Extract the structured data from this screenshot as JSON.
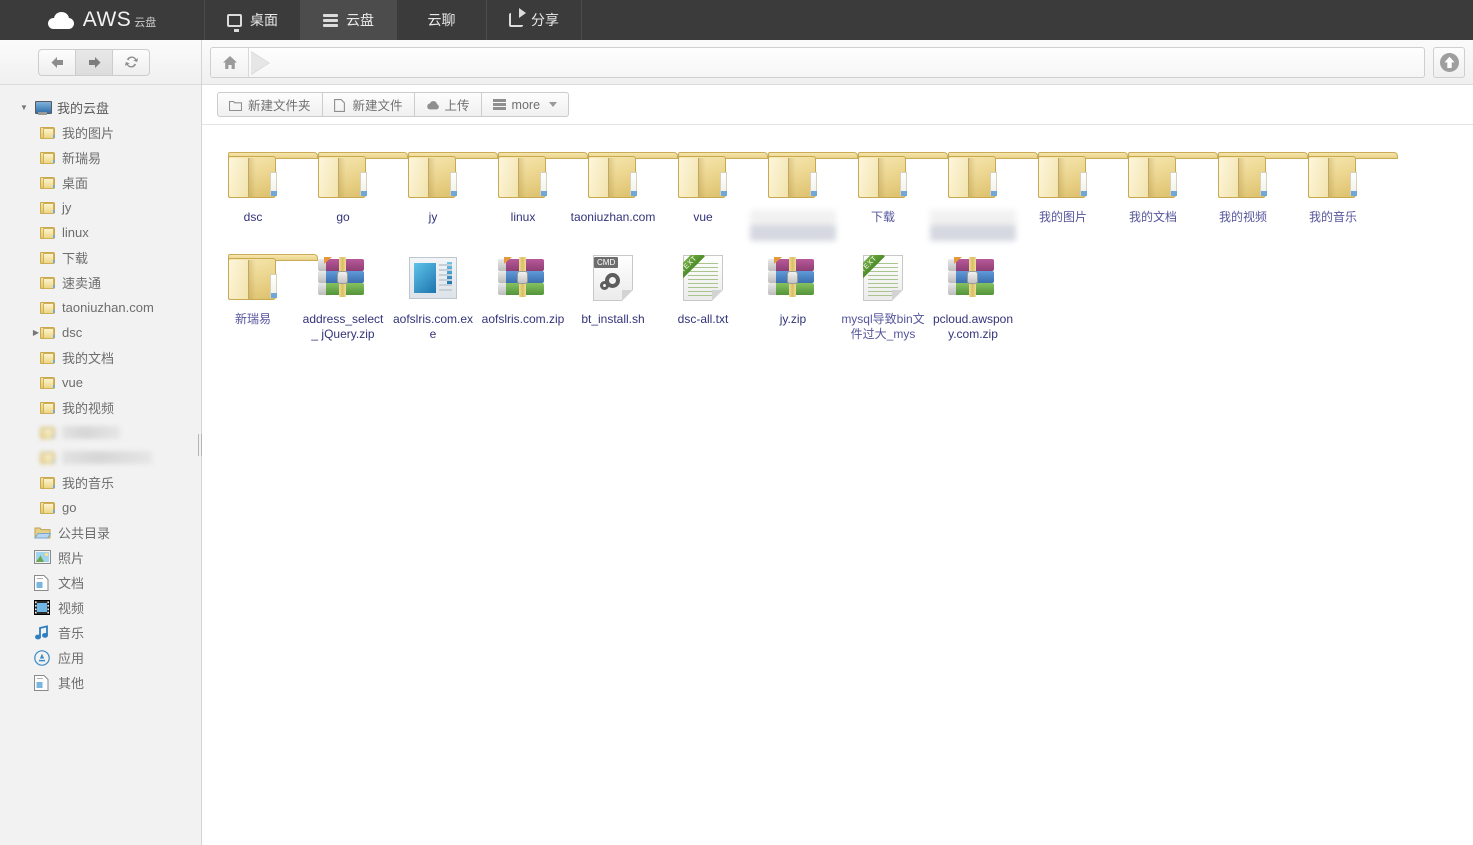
{
  "app": {
    "brand_name": "AWS",
    "brand_sub": "云盘",
    "tabs": [
      {
        "label": "桌面",
        "icon": "monitor-icon",
        "active": false
      },
      {
        "label": "云盘",
        "icon": "disk-icon",
        "active": true
      },
      {
        "label": "云聊",
        "icon": "none",
        "active": false
      },
      {
        "label": "分享",
        "icon": "share-icon",
        "active": false
      }
    ]
  },
  "nav": {
    "back_label": "←",
    "forward_label": "→",
    "refresh_label": "⟳"
  },
  "breadcrumb": {
    "home_icon": "home-icon",
    "path": "",
    "up_icon": "up-arrow-icon"
  },
  "toolbar": {
    "new_folder": "新建文件夹",
    "new_file": "新建文件",
    "upload": "上传",
    "more": "more"
  },
  "sidebar": {
    "root": {
      "label": "我的云盘",
      "icon": "computer-icon",
      "expanded": true
    },
    "children": [
      {
        "label": "我的图片",
        "icon": "folder-icon",
        "blurred": false,
        "twisty": false
      },
      {
        "label": "新瑞易",
        "icon": "folder-icon",
        "blurred": false,
        "twisty": false
      },
      {
        "label": "桌面",
        "icon": "folder-icon",
        "blurred": false,
        "twisty": false
      },
      {
        "label": "jy",
        "icon": "folder-icon",
        "blurred": false,
        "twisty": false
      },
      {
        "label": "linux",
        "icon": "folder-icon",
        "blurred": false,
        "twisty": false
      },
      {
        "label": "下载",
        "icon": "folder-icon",
        "blurred": false,
        "twisty": false
      },
      {
        "label": "速卖通",
        "icon": "folder-icon",
        "blurred": false,
        "twisty": false
      },
      {
        "label": "taoniuzhan.com",
        "icon": "folder-icon",
        "blurred": false,
        "twisty": false
      },
      {
        "label": "dsc",
        "icon": "folder-icon",
        "blurred": false,
        "twisty": true
      },
      {
        "label": "我的文档",
        "icon": "folder-icon",
        "blurred": false,
        "twisty": false
      },
      {
        "label": "vue",
        "icon": "folder-icon",
        "blurred": false,
        "twisty": false
      },
      {
        "label": "我的视频",
        "icon": "folder-icon",
        "blurred": false,
        "twisty": false
      },
      {
        "label": "",
        "icon": "folder-icon",
        "blurred": true,
        "twisty": false,
        "blur_width": 58
      },
      {
        "label": "",
        "icon": "folder-icon",
        "blurred": true,
        "twisty": false,
        "blur_width": 90
      },
      {
        "label": "我的音乐",
        "icon": "folder-icon",
        "blurred": false,
        "twisty": false
      },
      {
        "label": "go",
        "icon": "folder-icon",
        "blurred": false,
        "twisty": false
      }
    ],
    "sections": [
      {
        "label": "公共目录",
        "icon": "shared-folder-icon"
      },
      {
        "label": "照片",
        "icon": "photo-icon"
      },
      {
        "label": "文档",
        "icon": "document-icon"
      },
      {
        "label": "视频",
        "icon": "video-icon"
      },
      {
        "label": "音乐",
        "icon": "music-icon"
      },
      {
        "label": "应用",
        "icon": "app-icon"
      },
      {
        "label": "其他",
        "icon": "other-icon"
      }
    ]
  },
  "files": [
    {
      "name": "dsc",
      "type": "folder",
      "blurred": false
    },
    {
      "name": "go",
      "type": "folder",
      "blurred": false
    },
    {
      "name": "jy",
      "type": "folder",
      "blurred": false
    },
    {
      "name": "linux",
      "type": "folder",
      "blurred": false
    },
    {
      "name": "taoniuzhan.com",
      "type": "folder",
      "blurred": false
    },
    {
      "name": "vue",
      "type": "folder",
      "blurred": false
    },
    {
      "name": "",
      "type": "folder",
      "blurred": true
    },
    {
      "name": "下载",
      "type": "folder",
      "blurred": false
    },
    {
      "name": "",
      "type": "folder",
      "blurred": true
    },
    {
      "name": "我的图片",
      "type": "folder",
      "blurred": false
    },
    {
      "name": "我的文档",
      "type": "folder",
      "blurred": false
    },
    {
      "name": "我的视频",
      "type": "folder",
      "blurred": false
    },
    {
      "name": "我的音乐",
      "type": "folder",
      "blurred": false
    },
    {
      "name": "新瑞易",
      "type": "folder",
      "blurred": false
    },
    {
      "name": "address_select_ jQuery.zip",
      "type": "rar",
      "blurred": false
    },
    {
      "name": "aofslris.com.exe",
      "type": "exe",
      "blurred": false
    },
    {
      "name": "aofslris.com.zip",
      "type": "rar",
      "blurred": false
    },
    {
      "name": "bt_install.sh",
      "type": "sh",
      "blurred": false,
      "tag": "CMD"
    },
    {
      "name": "dsc-all.txt",
      "type": "txt",
      "blurred": false,
      "tag": "TEXT"
    },
    {
      "name": "jy.zip",
      "type": "rar",
      "blurred": false
    },
    {
      "name": "mysql导致bin文件过大_mys",
      "type": "txt",
      "blurred": false,
      "tag": "TEXT"
    },
    {
      "name": "pcloud.awspony.com.zip",
      "type": "rar",
      "blurred": false
    }
  ],
  "colors": {
    "topbar_bg": "#3b3b3b",
    "tab_active_bg": "#4c4c4c",
    "sidebar_bg": "#f2f2f2",
    "label_color": "#33337a",
    "folder_yellow": "#edd684",
    "bottom_strip": "#aab4c8"
  }
}
